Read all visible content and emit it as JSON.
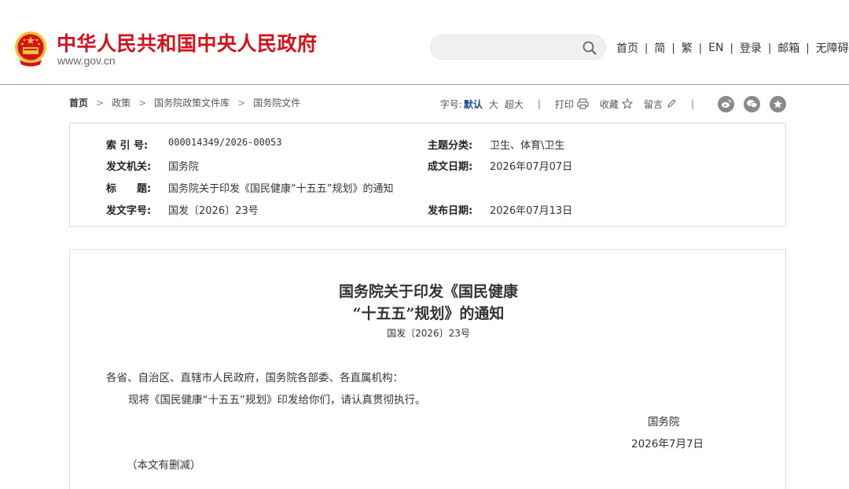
{
  "header": {
    "site_title": "中华人民共和国中央人民政府",
    "site_url": "www.gov.cn",
    "search": {
      "value": "",
      "placeholder": ""
    },
    "nav": [
      "首页",
      "简",
      "繁",
      "EN",
      "登录",
      "邮箱",
      "无障碍"
    ],
    "colors": {
      "title_red": "#d4121c",
      "emblem_red": "#d4121c",
      "emblem_gold": "#f2c12e"
    }
  },
  "breadcrumb": [
    "首页",
    "政策",
    "国务院政策文件库",
    "国务院文件"
  ],
  "tools": {
    "font_size_label": "字号:",
    "font_sizes": [
      "默认",
      "大",
      "超大"
    ],
    "print": "打印",
    "favorite": "收藏",
    "comment": "留言",
    "share_icons": [
      "weibo-icon",
      "wechat-icon",
      "qzone-icon"
    ]
  },
  "info": {
    "index_no": {
      "label": "索 引 号:",
      "value": "000014349/2026-00053"
    },
    "category": {
      "label": "主题分类:",
      "value": "卫生、体育\\卫生"
    },
    "issuer": {
      "label": "发文机关:",
      "value": "国务院"
    },
    "written_date": {
      "label": "成文日期:",
      "value": "2026年07月07日"
    },
    "subject": {
      "label": "标　　题:",
      "value": "国务院关于印发《国民健康“十五五”规划》的通知"
    },
    "doc_no": {
      "label": "发文字号:",
      "value": "国发〔2026〕23号"
    },
    "publish_date": {
      "label": "发布日期:",
      "value": "2026年07月13日"
    }
  },
  "article": {
    "title_line1": "国务院关于印发《国民健康",
    "title_line2": "“十五五”规划》的通知",
    "doc_no": "国发〔2026〕23号",
    "salutation": "各省、自治区、直辖市人民政府，国务院各部委、各直属机构：",
    "body": "现将《国民健康“十五五”规划》印发给你们，请认真贯彻执行。",
    "signature": "国务院",
    "date": "2026年7月7日",
    "note": "（本文有删减）"
  }
}
